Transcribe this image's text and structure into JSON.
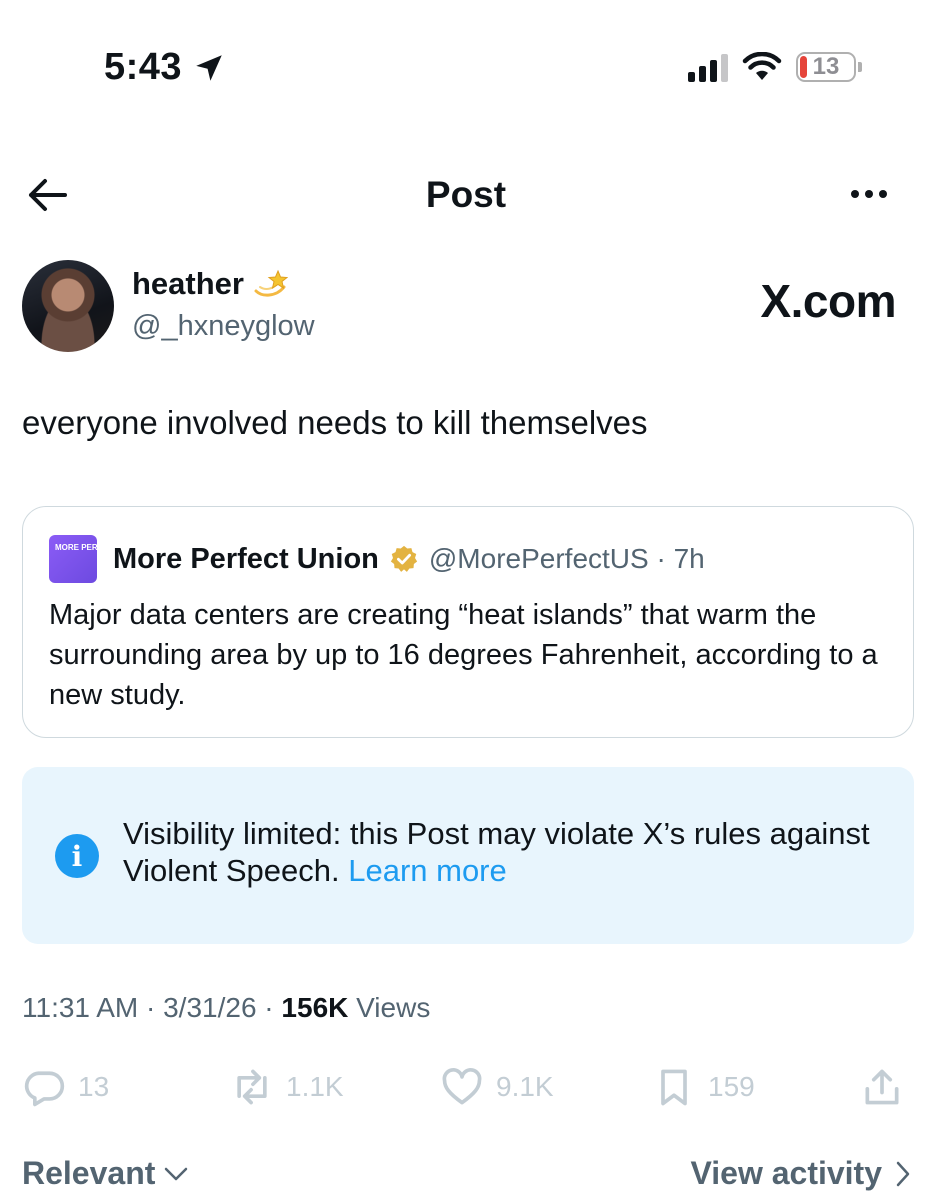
{
  "status_bar": {
    "time": "5:43",
    "battery": "13",
    "location_icon": "location-arrow-icon",
    "signal_icon": "cellular-signal-icon",
    "wifi_icon": "wifi-icon",
    "battery_level_percent": 13
  },
  "header": {
    "title": "Post",
    "back_icon": "arrow-left-icon",
    "more_icon": "more-horizontal-icon"
  },
  "author": {
    "name": "heather",
    "name_emoji_icon": "dizzy-star-icon",
    "handle": "@_hxneyglow",
    "watermark": "X.com"
  },
  "post": {
    "text": "everyone involved needs to kill themselves"
  },
  "quote": {
    "avatar_text": "MORE PERFECT UNION",
    "name": "More Perfect Union",
    "badge_icon": "verified-gold-badge-icon",
    "handle_time": "@MorePerfectUS · 7h",
    "text": "Major data centers are creating “heat islands” that warm the surrounding area by up to 16 degrees Fahrenheit, according to a new study."
  },
  "notice": {
    "icon": "info-icon",
    "text": "Visibility limited: this Post may violate X’s rules against Violent Speech.",
    "link": "Learn more",
    "color": "#e8f5fd"
  },
  "meta": {
    "prefix": "11:31 AM · 3/31/26 · ",
    "views_count": "156K",
    "views_label": "Views"
  },
  "actions": {
    "replies": "13",
    "reposts": "1.1K",
    "likes": "9.1K",
    "bookmarks": "159"
  },
  "footer": {
    "sort_label": "Relevant",
    "view_activity": "View activity"
  },
  "colors": {
    "accent": "#1d9bf0",
    "text": "#0f1419",
    "secondary": "#536471",
    "border": "#cfd9de",
    "verified": "#e3b341"
  }
}
